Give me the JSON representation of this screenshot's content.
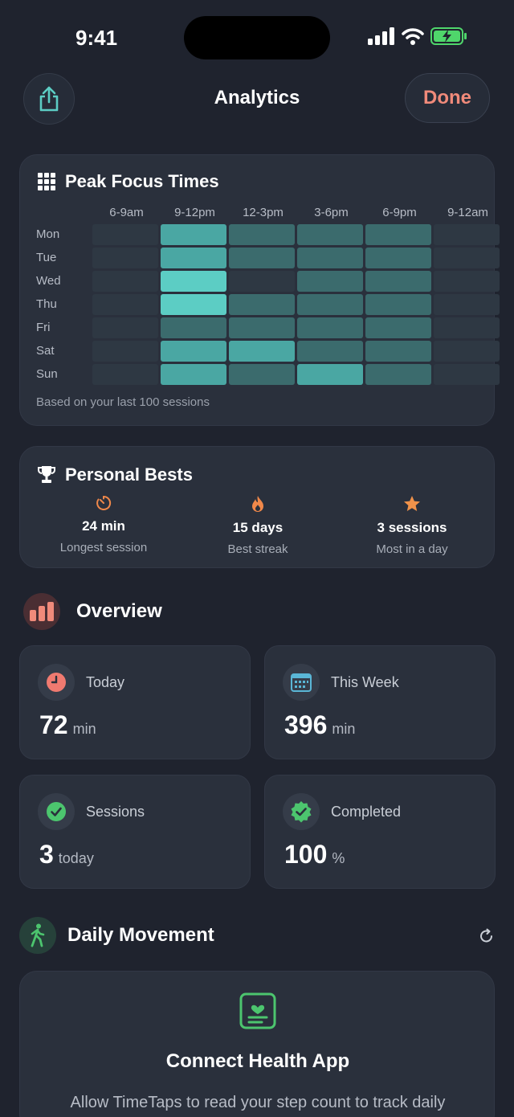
{
  "status": {
    "time": "9:41"
  },
  "nav": {
    "title": "Analytics",
    "done_label": "Done"
  },
  "peak": {
    "title": "Peak Focus Times",
    "columns": [
      "6-9am",
      "9-12pm",
      "12-3pm",
      "3-6pm",
      "6-9pm",
      "9-12am"
    ],
    "rows": [
      {
        "day": "Mon",
        "levels": [
          0,
          3,
          2,
          2,
          2,
          0
        ]
      },
      {
        "day": "Tue",
        "levels": [
          0,
          3,
          2,
          2,
          2,
          0
        ]
      },
      {
        "day": "Wed",
        "levels": [
          0,
          4,
          0,
          2,
          2,
          0
        ]
      },
      {
        "day": "Thu",
        "levels": [
          0,
          4,
          2,
          2,
          2,
          0
        ]
      },
      {
        "day": "Fri",
        "levels": [
          0,
          2,
          2,
          2,
          2,
          0
        ]
      },
      {
        "day": "Sat",
        "levels": [
          0,
          3,
          3,
          2,
          2,
          0
        ]
      },
      {
        "day": "Sun",
        "levels": [
          0,
          3,
          2,
          3,
          2,
          0
        ]
      }
    ],
    "note": "Based on your last 100 sessions"
  },
  "bests": {
    "title": "Personal Bests",
    "items": [
      {
        "icon": "timer-icon",
        "value": "24 min",
        "label": "Longest session"
      },
      {
        "icon": "flame-icon",
        "value": "15 days",
        "label": "Best streak"
      },
      {
        "icon": "star-icon",
        "value": "3 sessions",
        "label": "Most in a day"
      }
    ]
  },
  "overview": {
    "title": "Overview",
    "today": {
      "label": "Today",
      "value": "72",
      "unit": "min"
    },
    "week": {
      "label": "This Week",
      "value": "396",
      "unit": "min"
    },
    "sessions": {
      "label": "Sessions",
      "value": "3",
      "unit": "today"
    },
    "completed": {
      "label": "Completed",
      "value": "100",
      "unit": "%"
    }
  },
  "movement": {
    "title": "Daily Movement",
    "card_title": "Connect Health App",
    "card_desc": "Allow TimeTaps to read your step count to track daily"
  },
  "colors": {
    "accent": "#5ccdc4",
    "done": "#f08a7a",
    "background": "#1f232e",
    "card": "#2a303c"
  }
}
